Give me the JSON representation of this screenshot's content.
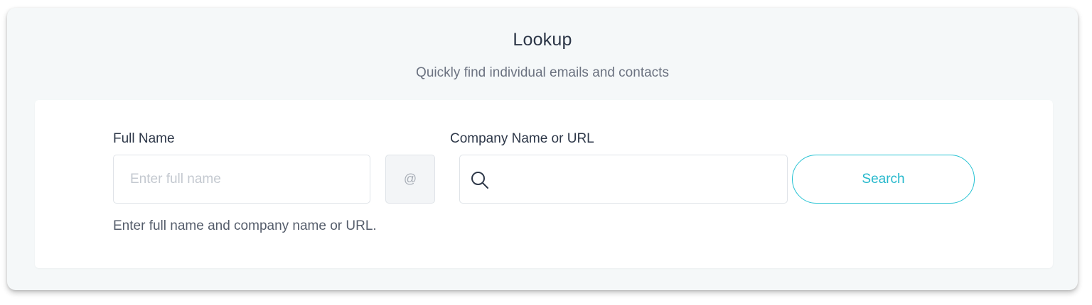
{
  "header": {
    "title": "Lookup",
    "subtitle": "Quickly find individual emails and contacts"
  },
  "form": {
    "full_name": {
      "label": "Full Name",
      "placeholder": "Enter full name",
      "value": ""
    },
    "at_symbol": "@",
    "company": {
      "label": "Company Name or URL",
      "placeholder": "",
      "value": "",
      "icon": "search-icon"
    },
    "search_button_label": "Search",
    "help_text": "Enter full name and company name or URL."
  },
  "colors": {
    "accent": "#25c2d3",
    "card_background": "#f5f8f9",
    "panel_background": "#ffffff",
    "text_primary": "#2d3748",
    "text_secondary": "#6b7280"
  }
}
